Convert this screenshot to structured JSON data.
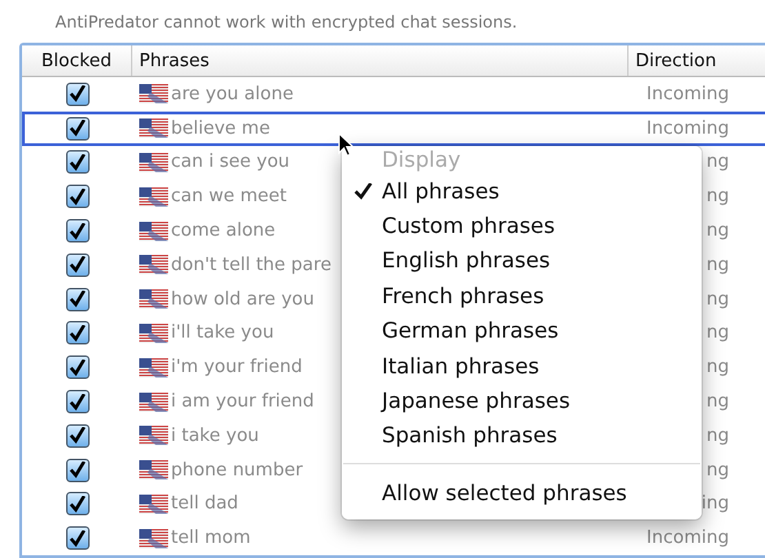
{
  "notice": "AntiPredator cannot work with encrypted chat sessions.",
  "table": {
    "columns": [
      "Blocked",
      "Phrases",
      "Direction"
    ],
    "rows": [
      {
        "blocked": true,
        "phrase": "are you alone",
        "direction": "Incoming",
        "selected": false
      },
      {
        "blocked": true,
        "phrase": "believe me",
        "direction": "Incoming",
        "selected": true
      },
      {
        "blocked": true,
        "phrase": "can i see you",
        "direction": "ng",
        "selected": false
      },
      {
        "blocked": true,
        "phrase": "can we meet",
        "direction": "ng",
        "selected": false
      },
      {
        "blocked": true,
        "phrase": "come alone",
        "direction": "ng",
        "selected": false
      },
      {
        "blocked": true,
        "phrase": "don't tell the pare",
        "direction": "ng",
        "selected": false
      },
      {
        "blocked": true,
        "phrase": "how old are you",
        "direction": "ng",
        "selected": false
      },
      {
        "blocked": true,
        "phrase": "i'll take you",
        "direction": "ng",
        "selected": false
      },
      {
        "blocked": true,
        "phrase": "i'm your friend",
        "direction": "ng",
        "selected": false
      },
      {
        "blocked": true,
        "phrase": "i am your friend",
        "direction": "ng",
        "selected": false
      },
      {
        "blocked": true,
        "phrase": "i take you",
        "direction": "ng",
        "selected": false
      },
      {
        "blocked": true,
        "phrase": "phone number",
        "direction": "ng",
        "selected": false
      },
      {
        "blocked": true,
        "phrase": "tell dad",
        "direction": "ing",
        "selected": false
      },
      {
        "blocked": true,
        "phrase": "tell mom",
        "direction": "Incoming",
        "selected": false
      }
    ]
  },
  "context_menu": {
    "items": [
      {
        "kind": "header",
        "label": "Display"
      },
      {
        "kind": "option",
        "label": "All phrases",
        "checked": true
      },
      {
        "kind": "option",
        "label": "Custom phrases",
        "checked": false
      },
      {
        "kind": "option",
        "label": "English phrases",
        "checked": false
      },
      {
        "kind": "option",
        "label": "French phrases",
        "checked": false
      },
      {
        "kind": "option",
        "label": "German phrases",
        "checked": false
      },
      {
        "kind": "option",
        "label": "Italian phrases",
        "checked": false
      },
      {
        "kind": "option",
        "label": "Japanese phrases",
        "checked": false
      },
      {
        "kind": "option",
        "label": "Spanish phrases",
        "checked": false
      },
      {
        "kind": "separator"
      },
      {
        "kind": "action",
        "label": "Allow selected phrases"
      }
    ]
  }
}
